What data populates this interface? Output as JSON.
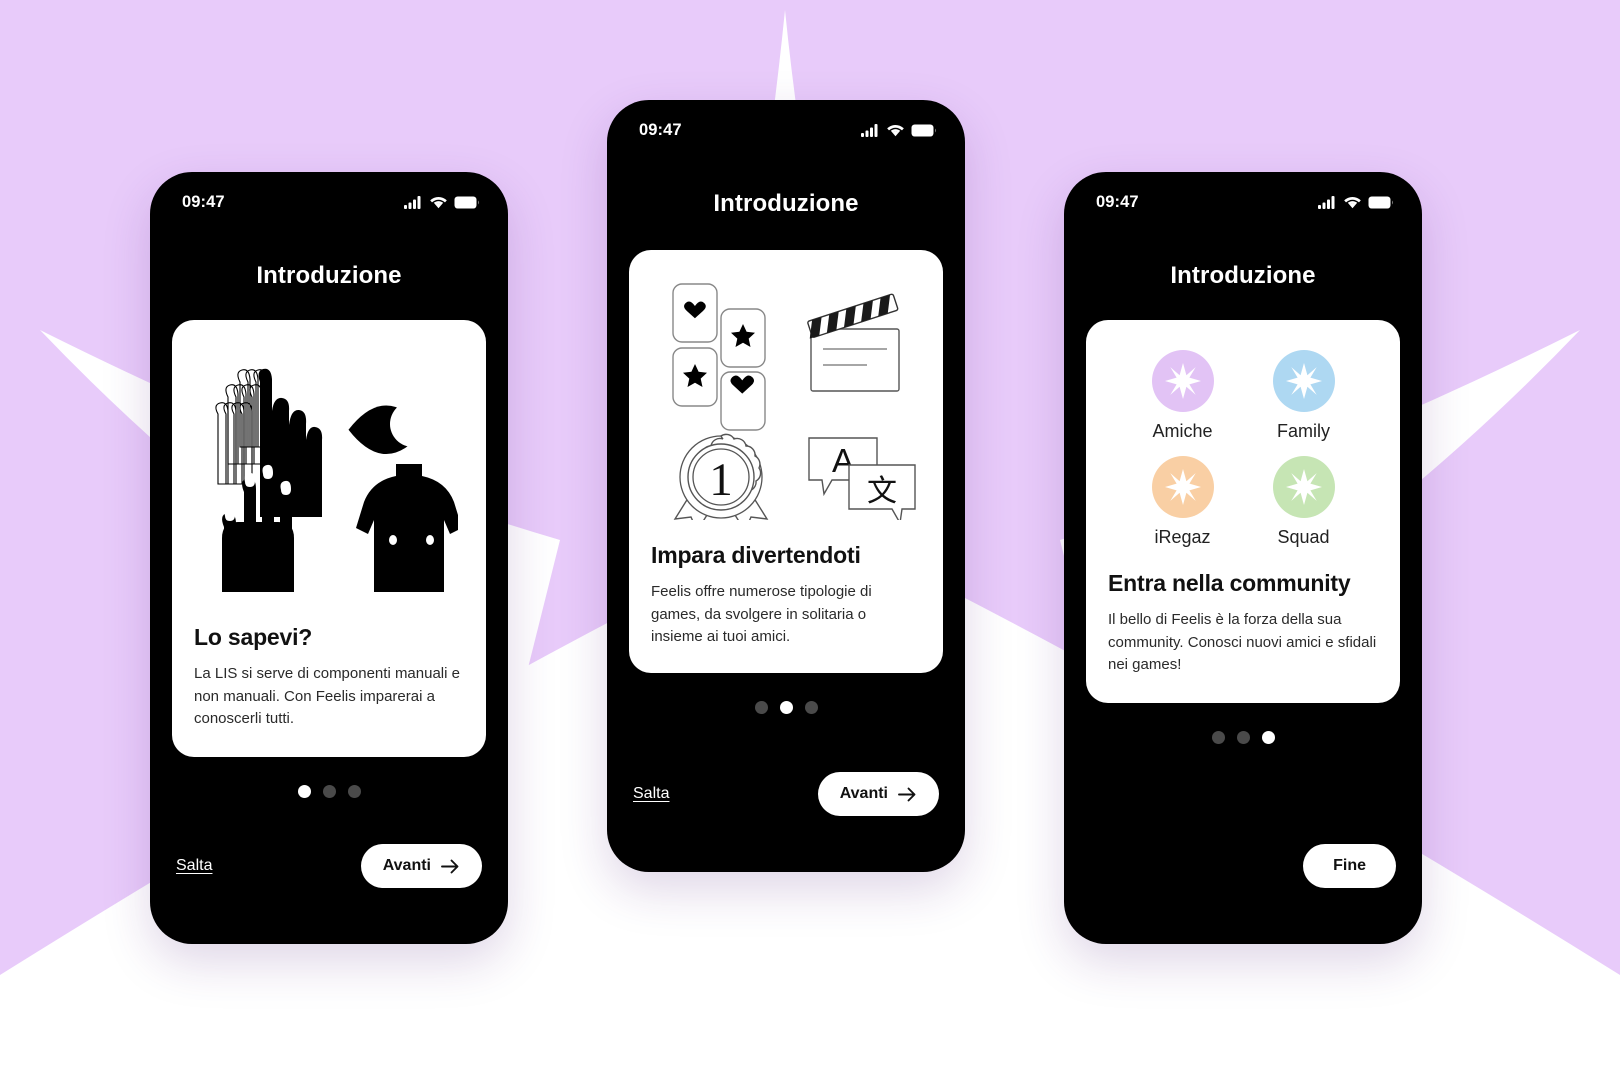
{
  "background": {
    "canvas_color": "#e8cbfa",
    "sparkle_color": "#ffffff"
  },
  "status_bar": {
    "time": "09:47",
    "icons": [
      "cellular-signal-icon",
      "wifi-icon",
      "battery-icon"
    ]
  },
  "screens": [
    {
      "id": "screen-1",
      "title": "Introduzione",
      "illustration": "lis-components-illustration",
      "card_title": "Lo sapevi?",
      "card_body": "La LIS si serve di componenti manuali e non manuali. Con Feelis imparerai a conoscerli tutti.",
      "dots": {
        "count": 3,
        "active": 0
      },
      "skip_label": "Salta",
      "next_label": "Avanti",
      "next_icon": "arrow-right-icon"
    },
    {
      "id": "screen-2",
      "title": "Introduzione",
      "illustration": "games-illustration",
      "card_title": "Impara divertendoti",
      "card_body": "Feelis offre numerose tipologie di games, da svolgere in solitaria o insieme ai tuoi amici.",
      "dots": {
        "count": 3,
        "active": 1
      },
      "skip_label": "Salta",
      "next_label": "Avanti",
      "next_icon": "arrow-right-icon"
    },
    {
      "id": "screen-3",
      "title": "Introduzione",
      "illustration": "community-groups-illustration",
      "community": [
        {
          "label": "Amiche",
          "color": "#e2c3f5",
          "icon": "sparkle-star-icon"
        },
        {
          "label": "Family",
          "color": "#aed8f2",
          "icon": "sparkle-star-icon"
        },
        {
          "label": "iRegaz",
          "color": "#f9cfa4",
          "icon": "sparkle-star-icon"
        },
        {
          "label": "Squad",
          "color": "#c6e5b4",
          "icon": "sparkle-star-icon"
        }
      ],
      "card_title": "Entra nella community",
      "card_body": "Il bello di Feelis è la forza della sua community. Conosci nuovi amici e sfidali nei games!",
      "dots": {
        "count": 3,
        "active": 2
      },
      "done_label": "Fine"
    }
  ],
  "illustration_2_items": [
    "memory-cards-icon",
    "clapperboard-icon",
    "award-ribbon-1-icon",
    "translate-bubbles-icon"
  ]
}
